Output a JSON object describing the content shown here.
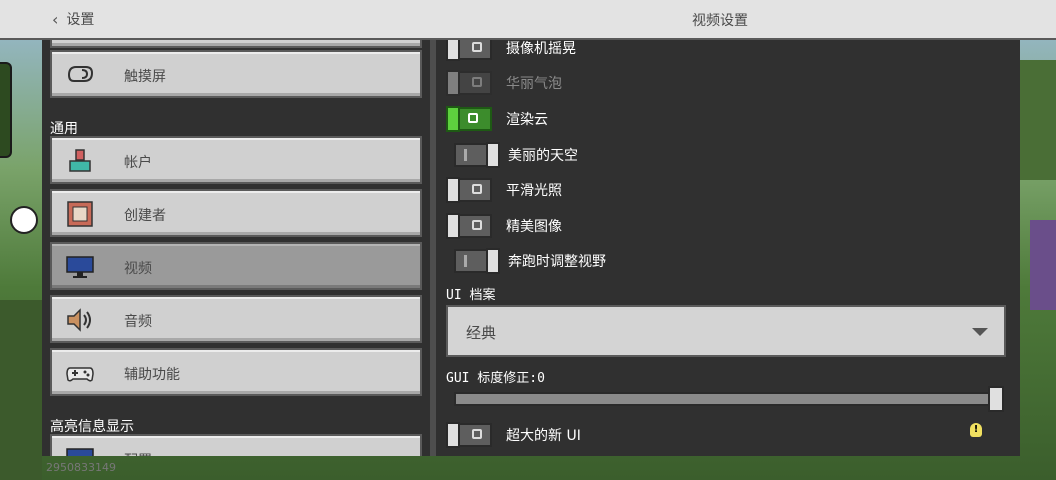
{
  "colors": {
    "toggle_on": "#5ed03e",
    "panel_bg": "#303030",
    "button_bg": "#d0d0d0",
    "active_button_bg": "#9a9a9a"
  },
  "header": {
    "back_label": "设置",
    "title": "视频设置"
  },
  "sidebar": {
    "top_item": {
      "label": "触摸屏",
      "icon": "touch-hand-icon"
    },
    "section_general": "通用",
    "items": [
      {
        "label": "帐户",
        "icon": "account-icon",
        "active": false
      },
      {
        "label": "创建者",
        "icon": "creator-icon",
        "active": false
      },
      {
        "label": "视频",
        "icon": "monitor-icon",
        "active": true
      },
      {
        "label": "音频",
        "icon": "speaker-icon",
        "active": false
      },
      {
        "label": "辅助功能",
        "icon": "gamepad-icon",
        "active": false
      }
    ],
    "section_highlight": "高亮信息显示",
    "partial_item": {
      "label": "配置",
      "icon": "monitor-icon"
    },
    "id_hint": "2950833149"
  },
  "settings": {
    "toggles": [
      {
        "label": "摄像机摇晃",
        "state": "off",
        "disabled": false
      },
      {
        "label": "华丽气泡",
        "state": "off",
        "disabled": true
      },
      {
        "label": "渲染云",
        "state": "on",
        "disabled": false
      },
      {
        "label": "美丽的天空",
        "state": "off-alt",
        "disabled": false
      },
      {
        "label": "平滑光照",
        "state": "off",
        "disabled": false
      },
      {
        "label": "精美图像",
        "state": "off",
        "disabled": false
      },
      {
        "label": "奔跑时调整视野",
        "state": "off-alt",
        "disabled": false
      }
    ],
    "ui_profile_label": "UI 档案",
    "ui_profile_value": "经典",
    "gui_scale_label": "GUI 标度修正:0",
    "gui_scale_value": 0,
    "large_ui_label": "超大的新 UI",
    "large_ui_state": "off"
  }
}
